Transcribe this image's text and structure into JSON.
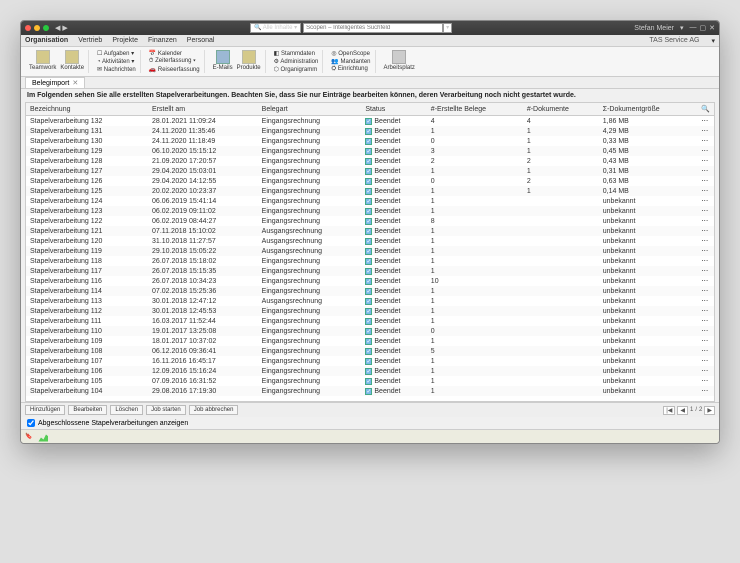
{
  "titlebar": {
    "searchScope": "Alle Inhalte",
    "searchPlaceholder": "Scopen – Intelligentes Suchfeld",
    "user": "Stefan Meier"
  },
  "menubar": {
    "items": [
      "Organisation",
      "Vertrieb",
      "Projekte",
      "Finanzen",
      "Personal"
    ],
    "company": "TAS Service AG"
  },
  "ribbon": {
    "teamwork": "Teamwork",
    "kontakte": "Kontakte",
    "aufgaben": "Aufgaben",
    "aktivitaeten": "Aktivitäten",
    "nachrichten": "Nachrichten",
    "kalender": "Kalender",
    "zeiterfassung": "Zeiterfassung",
    "reiseerfassung": "Reiseerfassung",
    "emails": "E-Mails",
    "produkte": "Produkte",
    "stammdaten": "Stammdaten",
    "administration": "Administration",
    "organigramm": "Organigramm",
    "openscope": "OpenScope",
    "mandanten": "Mandanten",
    "einrichtung": "Einrichtung",
    "arbeitsplatz": "Arbeitsplatz"
  },
  "tab": {
    "label": "Belegimport"
  },
  "instruction": "Im Folgenden sehen Sie alle erstellten Stapelverarbeitungen. Beachten Sie, dass Sie nur Einträge bearbeiten können, deren Verarbeitung noch nicht gestartet wurde.",
  "columns": [
    "Bezeichnung",
    "Erstellt am",
    "Belegart",
    "Status",
    "#-Erstellte Belege",
    "#-Dokumente",
    "Σ-Dokumentgröße"
  ],
  "statusLabel": "Beendet",
  "rows": [
    {
      "name": "Stapelverarbeitung 132",
      "date": "28.01.2021 11:09:24",
      "type": "Eingangsrechnung",
      "created": "4",
      "docs": "4",
      "size": "1,86 MB"
    },
    {
      "name": "Stapelverarbeitung 131",
      "date": "24.11.2020 11:35:46",
      "type": "Eingangsrechnung",
      "created": "1",
      "docs": "1",
      "size": "4,29 MB"
    },
    {
      "name": "Stapelverarbeitung 130",
      "date": "24.11.2020 11:18:49",
      "type": "Eingangsrechnung",
      "created": "0",
      "docs": "1",
      "size": "0,33 MB"
    },
    {
      "name": "Stapelverarbeitung 129",
      "date": "06.10.2020 15:15:12",
      "type": "Eingangsrechnung",
      "created": "3",
      "docs": "1",
      "size": "0,45 MB"
    },
    {
      "name": "Stapelverarbeitung 128",
      "date": "21.09.2020 17:20:57",
      "type": "Eingangsrechnung",
      "created": "2",
      "docs": "2",
      "size": "0,43 MB"
    },
    {
      "name": "Stapelverarbeitung 127",
      "date": "29.04.2020 15:03:01",
      "type": "Eingangsrechnung",
      "created": "1",
      "docs": "1",
      "size": "0,31 MB"
    },
    {
      "name": "Stapelverarbeitung 126",
      "date": "29.04.2020 14:12:55",
      "type": "Eingangsrechnung",
      "created": "0",
      "docs": "2",
      "size": "0,63 MB"
    },
    {
      "name": "Stapelverarbeitung 125",
      "date": "20.02.2020 10:23:37",
      "type": "Eingangsrechnung",
      "created": "1",
      "docs": "1",
      "size": "0,14 MB"
    },
    {
      "name": "Stapelverarbeitung 124",
      "date": "06.06.2019 15:41:14",
      "type": "Eingangsrechnung",
      "created": "1",
      "docs": "",
      "size": "unbekannt"
    },
    {
      "name": "Stapelverarbeitung 123",
      "date": "06.02.2019 09:11:02",
      "type": "Eingangsrechnung",
      "created": "1",
      "docs": "",
      "size": "unbekannt"
    },
    {
      "name": "Stapelverarbeitung 122",
      "date": "06.02.2019 08:44:27",
      "type": "Eingangsrechnung",
      "created": "8",
      "docs": "",
      "size": "unbekannt"
    },
    {
      "name": "Stapelverarbeitung 121",
      "date": "07.11.2018 15:10:02",
      "type": "Ausgangsrechnung",
      "created": "1",
      "docs": "",
      "size": "unbekannt"
    },
    {
      "name": "Stapelverarbeitung 120",
      "date": "31.10.2018 11:27:57",
      "type": "Ausgangsrechnung",
      "created": "1",
      "docs": "",
      "size": "unbekannt"
    },
    {
      "name": "Stapelverarbeitung 119",
      "date": "29.10.2018 15:05:22",
      "type": "Ausgangsrechnung",
      "created": "1",
      "docs": "",
      "size": "unbekannt"
    },
    {
      "name": "Stapelverarbeitung 118",
      "date": "26.07.2018 15:18:02",
      "type": "Eingangsrechnung",
      "created": "1",
      "docs": "",
      "size": "unbekannt"
    },
    {
      "name": "Stapelverarbeitung 117",
      "date": "26.07.2018 15:15:35",
      "type": "Eingangsrechnung",
      "created": "1",
      "docs": "",
      "size": "unbekannt"
    },
    {
      "name": "Stapelverarbeitung 116",
      "date": "26.07.2018 10:34:23",
      "type": "Eingangsrechnung",
      "created": "10",
      "docs": "",
      "size": "unbekannt"
    },
    {
      "name": "Stapelverarbeitung 114",
      "date": "07.02.2018 15:25:36",
      "type": "Eingangsrechnung",
      "created": "1",
      "docs": "",
      "size": "unbekannt"
    },
    {
      "name": "Stapelverarbeitung 113",
      "date": "30.01.2018 12:47:12",
      "type": "Ausgangsrechnung",
      "created": "1",
      "docs": "",
      "size": "unbekannt"
    },
    {
      "name": "Stapelverarbeitung 112",
      "date": "30.01.2018 12:45:53",
      "type": "Eingangsrechnung",
      "created": "1",
      "docs": "",
      "size": "unbekannt"
    },
    {
      "name": "Stapelverarbeitung 111",
      "date": "16.03.2017 11:52:44",
      "type": "Eingangsrechnung",
      "created": "1",
      "docs": "",
      "size": "unbekannt"
    },
    {
      "name": "Stapelverarbeitung 110",
      "date": "19.01.2017 13:25:08",
      "type": "Eingangsrechnung",
      "created": "0",
      "docs": "",
      "size": "unbekannt"
    },
    {
      "name": "Stapelverarbeitung 109",
      "date": "18.01.2017 10:37:02",
      "type": "Eingangsrechnung",
      "created": "1",
      "docs": "",
      "size": "unbekannt"
    },
    {
      "name": "Stapelverarbeitung 108",
      "date": "06.12.2016 09:36:41",
      "type": "Eingangsrechnung",
      "created": "5",
      "docs": "",
      "size": "unbekannt"
    },
    {
      "name": "Stapelverarbeitung 107",
      "date": "16.11.2016 16:45:17",
      "type": "Eingangsrechnung",
      "created": "1",
      "docs": "",
      "size": "unbekannt"
    },
    {
      "name": "Stapelverarbeitung 106",
      "date": "12.09.2016 15:16:24",
      "type": "Eingangsrechnung",
      "created": "1",
      "docs": "",
      "size": "unbekannt"
    },
    {
      "name": "Stapelverarbeitung 105",
      "date": "07.09.2016 16:31:52",
      "type": "Eingangsrechnung",
      "created": "1",
      "docs": "",
      "size": "unbekannt"
    },
    {
      "name": "Stapelverarbeitung 104",
      "date": "29.08.2016 17:19:30",
      "type": "Eingangsrechnung",
      "created": "1",
      "docs": "",
      "size": "unbekannt"
    }
  ],
  "actions": {
    "add": "Hinzufügen",
    "edit": "Bearbeiten",
    "delete": "Löschen",
    "jobStart": "Job starten",
    "jobCancel": "Job abbrechen"
  },
  "pager": {
    "page": "1",
    "total": "2"
  },
  "option": "Abgeschlossene Stapelverarbeitungen anzeigen"
}
